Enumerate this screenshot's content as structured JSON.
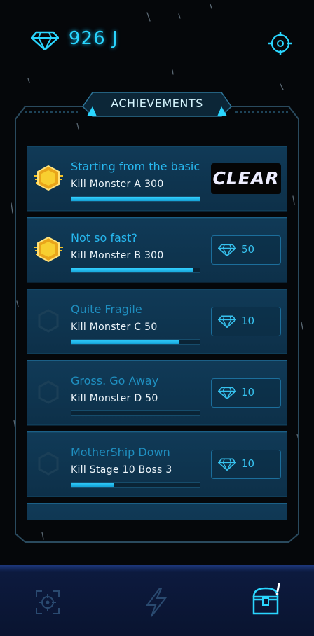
{
  "currency": {
    "amount": "926 J",
    "icon": "diamond-icon"
  },
  "header": {
    "title": "ACHIEVEMENTS"
  },
  "achievements": [
    {
      "name": "Starting from the basic",
      "task": "Kill Monster A 300",
      "progress": 1.0,
      "medal": "gold",
      "status": "CLEAR",
      "reward": ""
    },
    {
      "name": "Not so fast?",
      "task": "Kill Monster B 300",
      "progress": 0.95,
      "medal": "gold",
      "status": "",
      "reward": "50"
    },
    {
      "name": "Quite Fragile",
      "task": "Kill Monster C 50",
      "progress": 0.84,
      "medal": "empty",
      "status": "",
      "reward": "10"
    },
    {
      "name": "Gross. Go Away",
      "task": "Kill Monster D 50",
      "progress": 0.0,
      "medal": "empty",
      "status": "",
      "reward": "10"
    },
    {
      "name": "MotherShip Down",
      "task": "Kill Stage 10 Boss 3",
      "progress": 0.33,
      "medal": "empty",
      "status": "",
      "reward": "10"
    }
  ],
  "bottom_nav": [
    {
      "icon": "crosshair-icon",
      "active": false
    },
    {
      "icon": "lightning-icon",
      "active": false
    },
    {
      "icon": "treasure-chest-icon",
      "active": true,
      "alert": "!"
    }
  ],
  "colors": {
    "accent": "#2ad6ff",
    "gold": "#f5c326",
    "panel": "#0d3049"
  }
}
